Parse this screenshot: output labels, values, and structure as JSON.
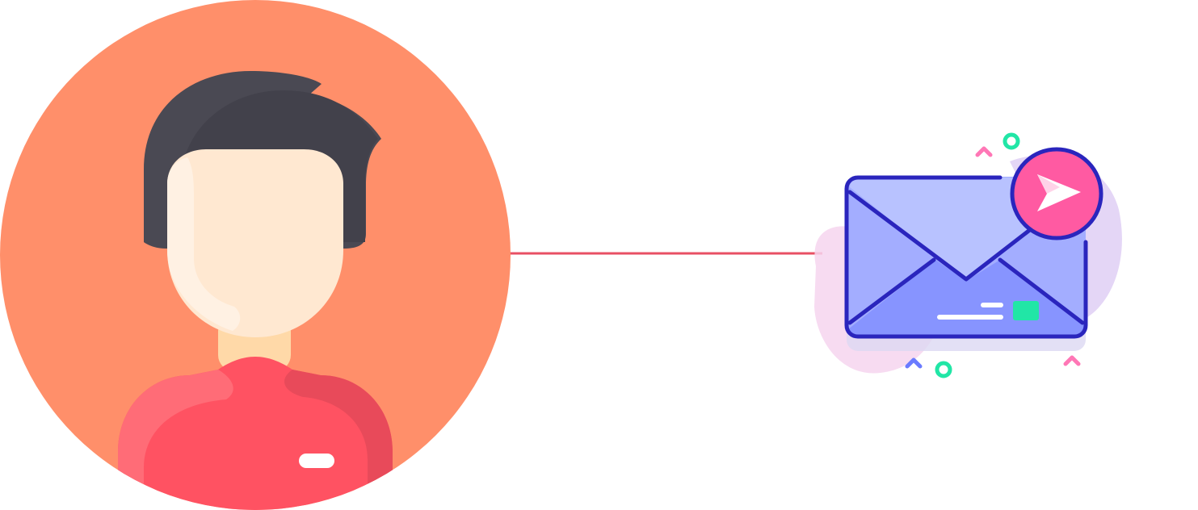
{
  "diagram": {
    "nodes": [
      {
        "id": "user",
        "icon": "user-avatar-icon"
      },
      {
        "id": "email",
        "icon": "send-email-icon"
      }
    ],
    "edges": [
      {
        "from": "user",
        "to": "email"
      }
    ]
  },
  "colors": {
    "avatar_bg": "#FF8F6A",
    "hair": "#4A4953",
    "face": "#FFE8D1",
    "shirt": "#FF5262",
    "connector": "#E85064",
    "envelope": "#A8B4FF",
    "envelope_stroke": "#2A25BD",
    "send_badge": "#FF5AA2",
    "accent_green": "#21E6A6"
  }
}
